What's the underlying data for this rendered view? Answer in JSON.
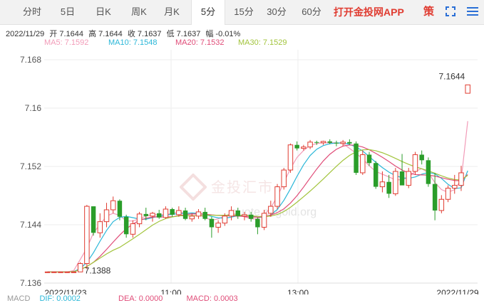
{
  "tabs": [
    {
      "label": "分时",
      "active": false
    },
    {
      "label": "5日",
      "active": false
    },
    {
      "label": "日K",
      "active": false
    },
    {
      "label": "周K",
      "active": false
    },
    {
      "label": "月K",
      "active": false
    },
    {
      "label": "5分",
      "active": true
    },
    {
      "label": "15分",
      "active": false
    },
    {
      "label": "30分",
      "active": false
    },
    {
      "label": "60分",
      "active": false
    }
  ],
  "app_link": "打开金投网APP",
  "ce_icon_text": "策",
  "ohlc": {
    "date": "2022/11/29",
    "open": "开 7.1644",
    "high": "高 7.1644",
    "close": "收 7.1637",
    "low": "低 7.1637",
    "change": "幅 -0.01%"
  },
  "ma": [
    {
      "label": "MA5: 7.1592",
      "color": "#f29bb8"
    },
    {
      "label": "MA10: 7.1548",
      "color": "#2bb7d8"
    },
    {
      "label": "MA20: 7.1532",
      "color": "#e04c78"
    },
    {
      "label": "MA30: 7.1529",
      "color": "#a2c43c"
    }
  ],
  "watermark": "金投汇市",
  "watermark_url": "quote.cngold.org",
  "bottom_peek": {
    "macd": "MACD",
    "dif": "DIF: 0.0002",
    "dea": "DEA: 0.0000",
    "macd_val": "MACD: 0.0003"
  },
  "chart_data": {
    "type": "candlestick",
    "title": "",
    "y_ticks": [
      "7.168",
      "7.16",
      "7.152",
      "7.144",
      "7.136"
    ],
    "x_ticks": [
      "2022/11/23",
      "11:00",
      "13:00",
      "2022/11/29"
    ],
    "ylim": [
      7.136,
      7.168
    ],
    "colors": {
      "up": "#e03c31",
      "down": "#2a9d2a",
      "grid": "#eeeeee"
    },
    "annotations": [
      {
        "text": "7.1644",
        "value": 7.1644,
        "candle_index": 64
      },
      {
        "text": "7.1388",
        "value": 7.1388,
        "candle_index": 5
      }
    ],
    "candles": [
      [
        7.1376,
        7.1376,
        7.1376,
        7.1376
      ],
      [
        7.1376,
        7.1376,
        7.1376,
        7.1376
      ],
      [
        7.1376,
        7.1376,
        7.1376,
        7.1376
      ],
      [
        7.1376,
        7.1376,
        7.1376,
        7.1376
      ],
      [
        7.1376,
        7.1376,
        7.1376,
        7.1376
      ],
      [
        7.1376,
        7.139,
        7.1376,
        7.1388
      ],
      [
        7.1388,
        7.1472,
        7.138,
        7.147
      ],
      [
        7.147,
        7.147,
        7.1428,
        7.1432
      ],
      [
        7.1432,
        7.146,
        7.1425,
        7.1448
      ],
      [
        7.1448,
        7.1475,
        7.144,
        7.1465
      ],
      [
        7.1465,
        7.1484,
        7.146,
        7.1478
      ],
      [
        7.1478,
        7.148,
        7.145,
        7.1455
      ],
      [
        7.1455,
        7.1458,
        7.1425,
        7.143
      ],
      [
        7.143,
        7.145,
        7.1425,
        7.1445
      ],
      [
        7.1445,
        7.1462,
        7.144,
        7.1459
      ],
      [
        7.1459,
        7.1468,
        7.145,
        7.1456
      ],
      [
        7.1456,
        7.1462,
        7.1448,
        7.146
      ],
      [
        7.146,
        7.1465,
        7.1452,
        7.1454
      ],
      [
        7.1454,
        7.147,
        7.1452,
        7.1466
      ],
      [
        7.1466,
        7.1468,
        7.1455,
        7.1458
      ],
      [
        7.1458,
        7.147,
        7.1455,
        7.1464
      ],
      [
        7.1464,
        7.1468,
        7.145,
        7.1452
      ],
      [
        7.1452,
        7.146,
        7.1448,
        7.1456
      ],
      [
        7.1456,
        7.1466,
        7.1452,
        7.1462
      ],
      [
        7.1462,
        7.1468,
        7.145,
        7.1452
      ],
      [
        7.1452,
        7.1455,
        7.1425,
        7.144
      ],
      [
        7.144,
        7.145,
        7.1432,
        7.1446
      ],
      [
        7.1446,
        7.146,
        7.1442,
        7.1456
      ],
      [
        7.1456,
        7.147,
        7.145,
        7.1464
      ],
      [
        7.1464,
        7.1468,
        7.1452,
        7.1456
      ],
      [
        7.1456,
        7.1462,
        7.145,
        7.1458
      ],
      [
        7.1458,
        7.1462,
        7.1448,
        7.1452
      ],
      [
        7.1452,
        7.1454,
        7.143,
        7.144
      ],
      [
        7.144,
        7.1465,
        7.1436,
        7.146
      ],
      [
        7.146,
        7.1478,
        7.1455,
        7.147
      ],
      [
        7.147,
        7.1502,
        7.1466,
        7.1498
      ],
      [
        7.1498,
        7.1525,
        7.1494,
        7.1522
      ],
      [
        7.1522,
        7.156,
        7.1518,
        7.1558
      ],
      [
        7.1558,
        7.1563,
        7.155,
        7.1553
      ],
      [
        7.1553,
        7.1558,
        7.155,
        7.1555
      ],
      [
        7.1555,
        7.1565,
        7.1552,
        7.1562
      ],
      [
        7.1562,
        7.1564,
        7.1558,
        7.1561
      ],
      [
        7.1561,
        7.1564,
        7.1558,
        7.1563
      ],
      [
        7.1563,
        7.1566,
        7.1559,
        7.1561
      ],
      [
        7.1561,
        7.1564,
        7.1556,
        7.156
      ],
      [
        7.156,
        7.1565,
        7.1556,
        7.1562
      ],
      [
        7.1562,
        7.1566,
        7.1558,
        7.156
      ],
      [
        7.156,
        7.1563,
        7.1515,
        7.1518
      ],
      [
        7.1518,
        7.155,
        7.1515,
        7.1544
      ],
      [
        7.1544,
        7.1548,
        7.1528,
        7.1532
      ],
      [
        7.1532,
        7.1535,
        7.1495,
        7.1498
      ],
      [
        7.1498,
        7.152,
        7.149,
        7.1505
      ],
      [
        7.1505,
        7.1515,
        7.1482,
        7.1488
      ],
      [
        7.1488,
        7.1525,
        7.1485,
        7.152
      ],
      [
        7.152,
        7.1545,
        7.151,
        7.15
      ],
      [
        7.15,
        7.1525,
        7.1496,
        7.152
      ],
      [
        7.152,
        7.1548,
        7.1515,
        7.1544
      ],
      [
        7.1544,
        7.155,
        7.153,
        7.1536
      ],
      [
        7.1536,
        7.154,
        7.1498,
        7.1502
      ],
      [
        7.1502,
        7.1518,
        7.145,
        7.1464
      ],
      [
        7.1464,
        7.1486,
        7.146,
        7.148
      ],
      [
        7.148,
        7.15,
        7.1476,
        7.1496
      ],
      [
        7.1496,
        7.1515,
        7.1488,
        7.15
      ],
      [
        7.15,
        7.1528,
        7.1492,
        7.1518
      ],
      [
        7.1632,
        7.1644,
        7.1632,
        7.1644
      ]
    ],
    "ma_lines": {
      "MA5": [
        7.1376,
        7.1376,
        7.1376,
        7.1376,
        7.1378,
        7.1394,
        7.141,
        7.1432,
        7.1444,
        7.1456,
        7.146,
        7.1457,
        7.1449,
        7.1449,
        7.1452,
        7.1456,
        7.1458,
        7.1458,
        7.1458,
        7.146,
        7.1462,
        7.146,
        7.146,
        7.1458,
        7.1454,
        7.145,
        7.1452,
        7.1456,
        7.146,
        7.1458,
        7.1455,
        7.1452,
        7.1452,
        7.1458,
        7.1468,
        7.1484,
        7.1504,
        7.1524,
        7.154,
        7.155,
        7.1557,
        7.156,
        7.1561,
        7.1561,
        7.1561,
        7.156,
        7.1553,
        7.1546,
        7.1538,
        7.1528,
        7.152,
        7.1516,
        7.1512,
        7.1508,
        7.1508,
        7.1512,
        7.152,
        7.1524,
        7.1518,
        7.1504,
        7.1494,
        7.149,
        7.1494,
        7.1508,
        7.1592
      ]
    }
  }
}
